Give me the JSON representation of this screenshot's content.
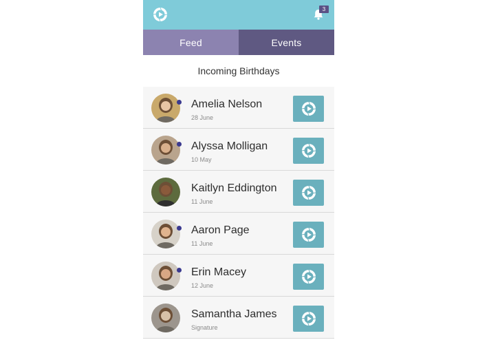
{
  "header": {
    "notification_count": "3",
    "logo_icon": "camera-shutter-play-icon",
    "bell_icon": "bell-icon"
  },
  "tabs": [
    {
      "label": "Feed",
      "active": true
    },
    {
      "label": "Events",
      "active": false
    }
  ],
  "section": {
    "title": "Incoming Birthdays"
  },
  "birthdays": [
    {
      "name": "Amelia Nelson",
      "date": "28 June",
      "online": true,
      "avatar_bg": "#c9a96b",
      "avatar_skin": "#e9c6a5"
    },
    {
      "name": "Alyssa Molligan",
      "date": "10 May",
      "online": true,
      "avatar_bg": "#b9a48d",
      "avatar_skin": "#d9b08c"
    },
    {
      "name": "Kaitlyn Eddington",
      "date": "11 June",
      "online": false,
      "avatar_bg": "#5d6b3e",
      "avatar_skin": "#8a5a3b"
    },
    {
      "name": "Aaron Page",
      "date": "11 June",
      "online": true,
      "avatar_bg": "#d7d2c9",
      "avatar_skin": "#e0b48f"
    },
    {
      "name": "Erin Macey",
      "date": "12 June",
      "online": true,
      "avatar_bg": "#cfc8bf",
      "avatar_skin": "#d9a784"
    },
    {
      "name": "Samantha James",
      "date": "Signature",
      "online": false,
      "avatar_bg": "#9c958d",
      "avatar_skin": "#d8c1a8"
    }
  ],
  "colors": {
    "topbar": "#7fcbd9",
    "tab_active": "#8c83b0",
    "tab_inactive": "#5f5982",
    "action_button": "#6ab0bd",
    "online_dot": "#3b3a8f"
  }
}
